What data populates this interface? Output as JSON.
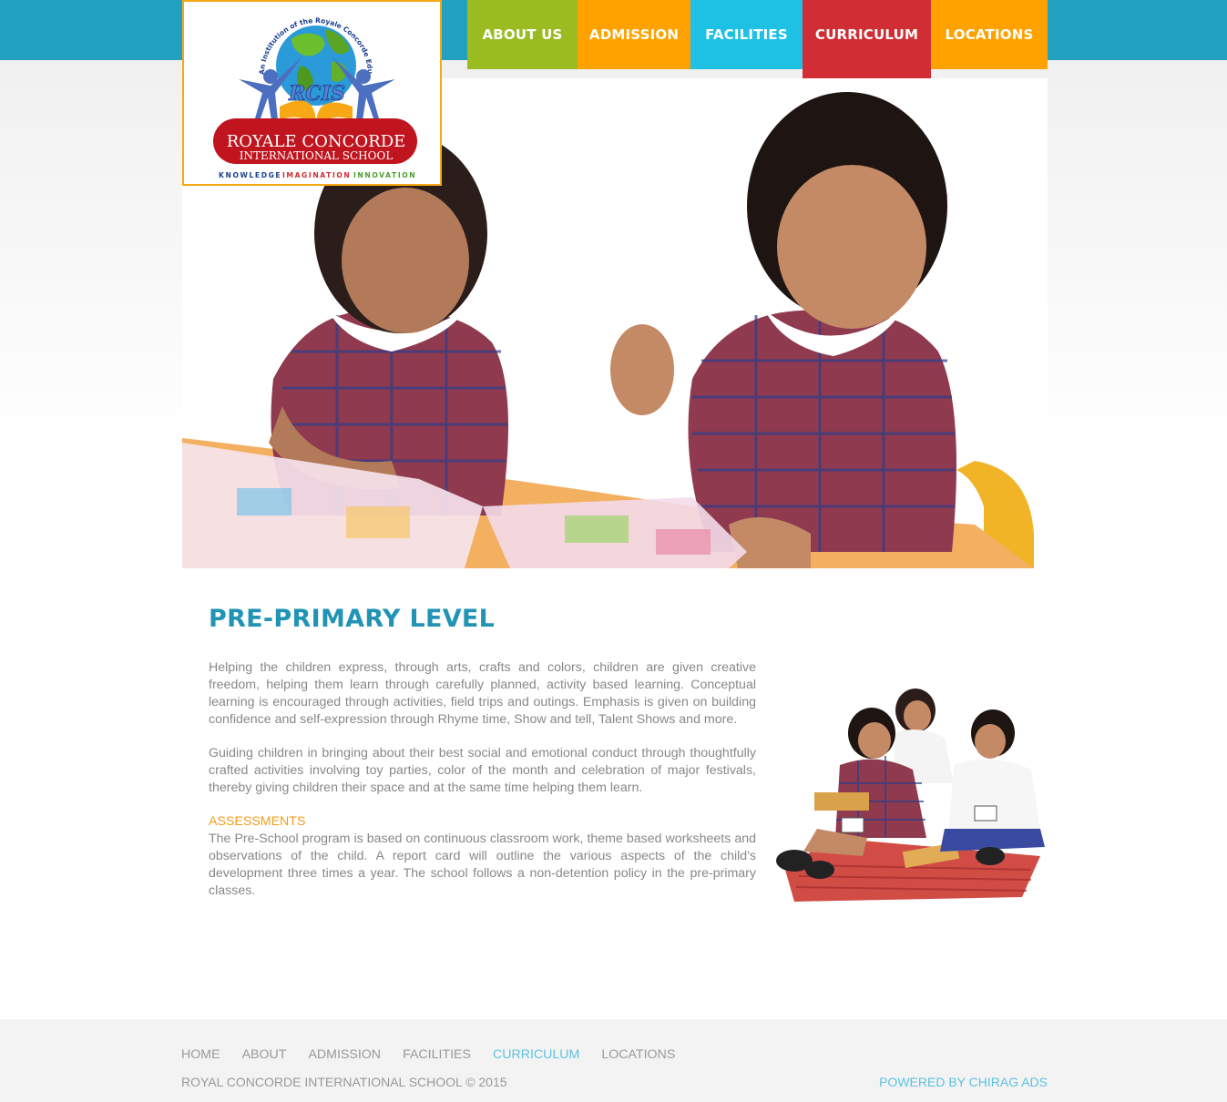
{
  "brand": {
    "arc_text": "An Institution of the Royale Concorde Educational Trust",
    "monogram": "RCIS",
    "name_line1": "ROYALE CONCORDE",
    "name_line2": "INTERNATIONAL SCHOOL",
    "tagline_1": "KNOWLEDGE",
    "tagline_2": "IMAGINATION",
    "tagline_3": "INNOVATION"
  },
  "nav": {
    "items": [
      {
        "label": "ABOUT US",
        "color": "#9abc20"
      },
      {
        "label": "ADMISSION",
        "color": "#ffa200"
      },
      {
        "label": "FACILITIES",
        "color": "#1ec1e4"
      },
      {
        "label": "CURRICULUM",
        "color": "#d12d34",
        "active": true
      },
      {
        "label": "LOCATIONS",
        "color": "#ffa200"
      }
    ]
  },
  "main": {
    "title": "PRE-PRIMARY LEVEL",
    "paragraph_1": "Helping the children express, through arts, crafts and colors, children are given creative freedom, helping them learn through carefully planned, activity based learning. Conceptual learning is encouraged through activities, field trips and outings. Emphasis is given on building confidence and self-expression through Rhyme time, Show and tell, Talent Shows and more.",
    "paragraph_2": "Guiding children in bringing about their best social and emotional conduct through thoughtfully crafted activities involving toy parties, color of the month and celebration of major festivals, thereby giving children their space and at the same time helping them learn.",
    "assessments_heading": "ASSESSMENTS",
    "assessments_text": "The Pre-School program is based on continuous classroom work, theme based worksheets and observations of the child. A report card will outline the various aspects of the child's development three times a year. The school follows a non-detention policy in the pre-primary classes."
  },
  "footer": {
    "links": [
      "HOME",
      "ABOUT",
      "ADMISSION",
      "FACILITIES",
      "CURRICULUM",
      "LOCATIONS"
    ],
    "active_link": "CURRICULUM",
    "copyright": "ROYAL CONCORDE INTERNATIONAL SCHOOL © 2015",
    "powered_by": "POWERED BY CHIRAG ADS"
  },
  "colors": {
    "topbar": "#22a0c0",
    "title": "#2193b5",
    "assessment_heading": "#f49c18",
    "footer_accent": "#5cc2e2",
    "logo_border": "#f7a814"
  }
}
